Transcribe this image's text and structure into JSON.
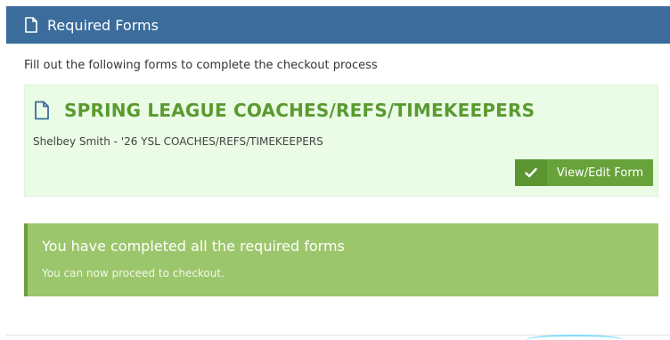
{
  "panel": {
    "header_title": "Required Forms",
    "header_icon": "document-icon"
  },
  "instructions": "Fill out the following forms to complete the checkout process",
  "form": {
    "icon": "document-icon",
    "title": "SPRING LEAGUE COACHES/REFS/TIMEKEEPERS",
    "subtitle": "Shelbey Smith - '26 YSL COACHES/REFS/TIMEKEEPERS",
    "button_label": "View/Edit Form",
    "button_icon": "check-icon"
  },
  "completion": {
    "title": "You have completed all the required forms",
    "message": "You can now proceed to checkout."
  },
  "colors": {
    "header_bg": "#3b6c9c",
    "form_card_bg": "#eafbe6",
    "form_title": "#5a9a30",
    "button_bg": "#67a33a",
    "complete_bg": "#9cc66b",
    "complete_border": "#6d9e3f"
  }
}
